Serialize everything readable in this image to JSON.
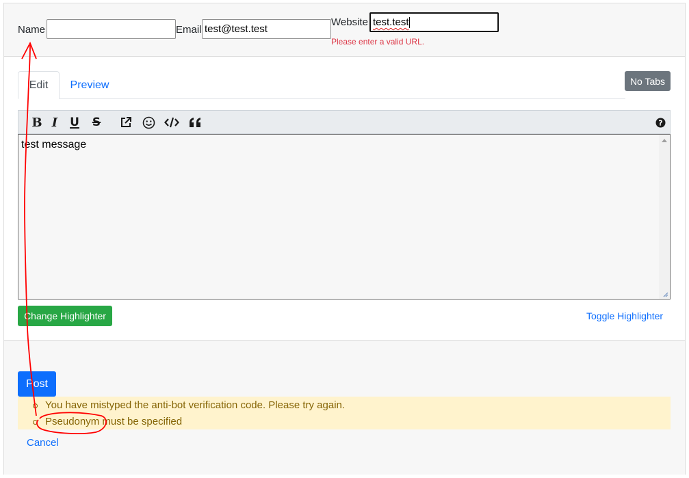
{
  "fields": {
    "name_label": "Name",
    "name_value": "",
    "email_label": "Email",
    "email_value": "test@test.test",
    "website_label": "Website",
    "website_value": "test.test",
    "website_error": "Please enter a valid URL."
  },
  "tabs": [
    {
      "label": "Edit",
      "active": true
    },
    {
      "label": "Preview",
      "active": false
    }
  ],
  "no_tabs_button": "No Tabs",
  "toolbar": {
    "buttons": [
      "bold-icon",
      "italic-icon",
      "underline-icon",
      "strikethrough-icon",
      "external-link-icon",
      "smiley-icon",
      "code-icon",
      "quote-icon"
    ],
    "help_icon": "help-icon"
  },
  "editor": {
    "text": "test message"
  },
  "change_highlighter_button": "Change Highlighter",
  "toggle_highlighter_link": "Toggle Highlighter",
  "post_button": "Post",
  "errors": [
    "You have mistyped the anti-bot verification code. Please try again.",
    "Pseudonym must be specified"
  ],
  "cancel_link": "Cancel",
  "colors": {
    "accent": "#0d6efd",
    "success": "#28a745",
    "secondary": "#6c757d",
    "warning_bg": "#fff3cd",
    "warning_text": "#856404",
    "error": "#dc3545",
    "annotation": "#ff0000"
  }
}
